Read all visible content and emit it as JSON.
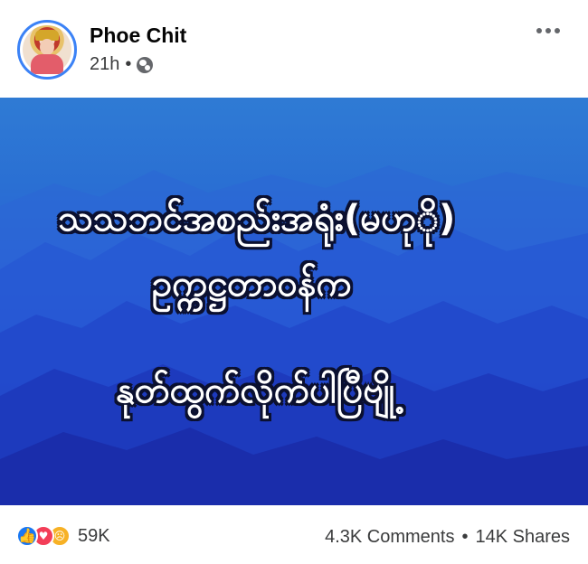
{
  "post": {
    "author": "Phoe Chit",
    "time": "21h",
    "separator": "•",
    "audience_icon": "globe-icon",
    "more_icon": "more-options-icon"
  },
  "media": {
    "lines": [
      "သသဘင်အစည်းအရုံး(မဟုို)",
      "ဥက္ကဋ္ဌတာဝန်က",
      "နုတ်ထွက်လိုက်ပါပြီဗျို့"
    ],
    "background": "blue mountains",
    "text_color": "#ffffff"
  },
  "footer": {
    "reaction_icons": [
      "like-icon",
      "love-icon",
      "sad-icon"
    ],
    "reaction_count": "59K",
    "comments": "4.3K Comments",
    "dot": "•",
    "shares": "14K Shares"
  },
  "colors": {
    "accent": "#1877f2",
    "avatar_ring": "#3b82f6"
  }
}
